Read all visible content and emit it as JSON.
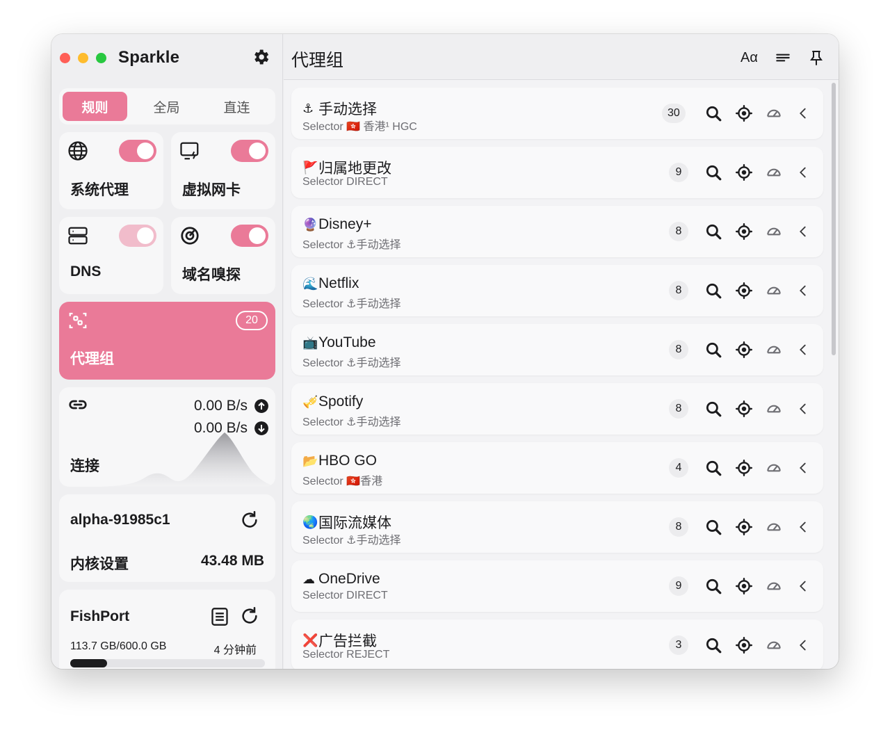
{
  "app": {
    "title": "Sparkle"
  },
  "sidebar": {
    "mode_tabs": [
      "规则",
      "全局",
      "直连"
    ],
    "tiles": [
      {
        "label": "系统代理",
        "icon": "globe-icon",
        "enabled": true
      },
      {
        "label": "虚拟网卡",
        "icon": "virtual-nic-icon",
        "enabled": true
      },
      {
        "label": "DNS",
        "icon": "server-icon",
        "enabled": false
      },
      {
        "label": "域名嗅探",
        "icon": "sniffer-icon",
        "enabled": true
      }
    ],
    "proxy_groups": {
      "label": "代理组",
      "count": "20"
    },
    "connections": {
      "label": "连接",
      "upload": "0.00 B/s",
      "download": "0.00 B/s"
    },
    "core": {
      "version": "alpha-91985c1",
      "label": "内核设置",
      "memory": "43.48 MB"
    },
    "profile": {
      "name": "FishPort",
      "usage": "113.7 GB/600.0 GB",
      "updated": "4 分钟前",
      "usage_fraction": 0.19
    }
  },
  "main": {
    "title": "代理组",
    "font_button": "Aα",
    "groups": [
      {
        "emoji": "⚓",
        "name": "手动选择",
        "subtitle": "Selector 🇭🇰 香港¹ HGC",
        "count": "30"
      },
      {
        "emoji": "🚩",
        "name": "归属地更改",
        "subtitle": "Selector DIRECT",
        "count": "9"
      },
      {
        "emoji": "🔮",
        "name": "Disney+",
        "subtitle": "Selector ⚓手动选择",
        "count": "8"
      },
      {
        "emoji": "🌊",
        "name": "Netflix",
        "subtitle": "Selector ⚓手动选择",
        "count": "8"
      },
      {
        "emoji": "📺",
        "name": "YouTube",
        "subtitle": "Selector ⚓手动选择",
        "count": "8"
      },
      {
        "emoji": "🎺",
        "name": "Spotify",
        "subtitle": "Selector ⚓手动选择",
        "count": "8"
      },
      {
        "emoji": "📂",
        "name": "HBO GO",
        "subtitle": "Selector 🇭🇰香港",
        "count": "4"
      },
      {
        "emoji": "🌏",
        "name": "国际流媒体",
        "subtitle": "Selector ⚓手动选择",
        "count": "8"
      },
      {
        "emoji": "☁",
        "name": "OneDrive",
        "subtitle": "Selector DIRECT",
        "count": "9"
      },
      {
        "emoji": "❌",
        "name": "广告拦截",
        "subtitle": "Selector REJECT",
        "count": "3"
      }
    ]
  },
  "colors": {
    "accent": "#ea7a98",
    "accent_dim": "#f1bccb"
  }
}
